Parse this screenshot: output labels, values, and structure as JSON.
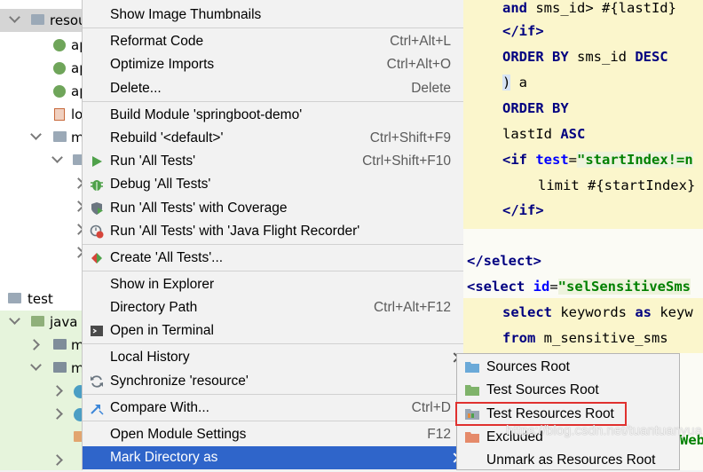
{
  "tree": {
    "items": [
      {
        "label": "resou",
        "icon": "folder-icon"
      },
      {
        "label": "ap",
        "icon": "spring-config-icon"
      },
      {
        "label": "ap",
        "icon": "spring-config-icon"
      },
      {
        "label": "ap",
        "icon": "spring-config-icon"
      },
      {
        "label": "lo",
        "icon": "xml-file-icon"
      },
      {
        "label": "m",
        "icon": "folder-icon"
      },
      {
        "label": "m",
        "icon": "folder-icon"
      },
      {
        "label": "test",
        "icon": "folder-icon"
      },
      {
        "label": "java",
        "icon": "test-sources-folder-icon"
      },
      {
        "label": "m",
        "icon": "package-icon"
      },
      {
        "label": "m",
        "icon": "package-icon"
      }
    ]
  },
  "menu": {
    "items": [
      {
        "label": "Show Image Thumbnails",
        "shortcut": ""
      },
      {
        "label": "Reformat Code",
        "shortcut": "Ctrl+Alt+L"
      },
      {
        "label": "Optimize Imports",
        "shortcut": "Ctrl+Alt+O"
      },
      {
        "label": "Delete...",
        "shortcut": "Delete"
      },
      {
        "label": "Build Module 'springboot-demo'",
        "shortcut": ""
      },
      {
        "label": "Rebuild '<default>'",
        "shortcut": "Ctrl+Shift+F9"
      },
      {
        "label": "Run 'All Tests'",
        "shortcut": "Ctrl+Shift+F10",
        "icon": "run-icon"
      },
      {
        "label": "Debug 'All Tests'",
        "shortcut": "",
        "icon": "debug-bug-icon"
      },
      {
        "label": "Run 'All Tests' with Coverage",
        "shortcut": "",
        "icon": "coverage-shield-icon"
      },
      {
        "label": "Run 'All Tests' with 'Java Flight Recorder'",
        "shortcut": "",
        "icon": "flight-recorder-icon"
      },
      {
        "label": "Create 'All Tests'...",
        "shortcut": "",
        "icon": "create-config-icon"
      },
      {
        "label": "Show in Explorer",
        "shortcut": ""
      },
      {
        "label": "Directory Path",
        "shortcut": "Ctrl+Alt+F12"
      },
      {
        "label": "Open in Terminal",
        "shortcut": "",
        "icon": "terminal-icon"
      },
      {
        "label": "Local History",
        "shortcut": ""
      },
      {
        "label": "Synchronize 'resource'",
        "shortcut": "",
        "icon": "sync-icon"
      },
      {
        "label": "Compare With...",
        "shortcut": "Ctrl+D",
        "icon": "compare-arrows-icon"
      },
      {
        "label": "Open Module Settings",
        "shortcut": "F12"
      },
      {
        "label": "Mark Directory as",
        "shortcut": ""
      }
    ]
  },
  "submenu": {
    "items": [
      {
        "label": "Sources Root",
        "icon": "sources-root-folder-icon",
        "color": "#6aa9d8"
      },
      {
        "label": "Test Sources Root",
        "icon": "test-sources-root-folder-icon",
        "color": "#7fb36a"
      },
      {
        "label": "Test Resources Root",
        "icon": "test-resources-root-folder-icon",
        "color": "#9aa6b4"
      },
      {
        "label": "Excluded",
        "icon": "excluded-folder-icon",
        "color": "#e58a6a"
      },
      {
        "label": "Unmark as Resources Root",
        "icon": "",
        "color": ""
      }
    ],
    "highlighted": "Test Resources Root"
  },
  "editor": {
    "lines": [
      "and sms_id> #{lastId}",
      "</if>",
      "ORDER BY sms_id DESC",
      ") a",
      "ORDER BY",
      "lastId ASC",
      "<if test=\"startIndex!=n",
      "limit #{startIndex}",
      "</if>",
      "</select>",
      "<select id=\"selSensitiveSms",
      "select keywords as keyw",
      "from m_sensitive_sms",
      "Web"
    ]
  },
  "watermark": "https://blog.csdn.net/tuantuanyua",
  "colors": {
    "selection": "#2f65ca",
    "highlight_box": "#e0312f",
    "editor_highlight": "#fbf6cc"
  }
}
